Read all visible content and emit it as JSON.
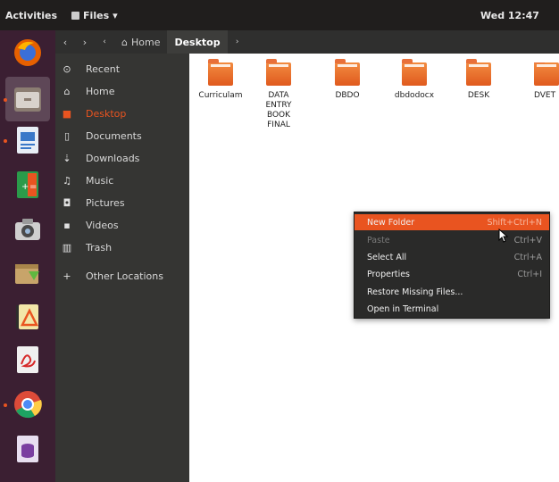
{
  "topbar": {
    "activities": "Activities",
    "app_name": "Files",
    "clock": "Wed 12:47"
  },
  "dock": {
    "items": [
      {
        "name": "firefox-icon",
        "color": "#e66000"
      },
      {
        "name": "files-icon",
        "color": "#8b7d72"
      },
      {
        "name": "writer-icon",
        "color": "#3a78c8"
      },
      {
        "name": "calc-icon",
        "color": "#2a9b4a"
      },
      {
        "name": "camera-icon",
        "color": "#9a9a9a"
      },
      {
        "name": "software-install-icon",
        "color": "#c8a46a"
      },
      {
        "name": "draw-icon",
        "color": "#2c2c2c"
      },
      {
        "name": "pdf-reader-icon",
        "color": "#d0d0d0"
      },
      {
        "name": "chrome-icon",
        "color": "#dd4b39"
      },
      {
        "name": "base-icon",
        "color": "#7a3fa0"
      }
    ]
  },
  "header": {
    "back": "‹",
    "forward": "›",
    "home_label": "Home",
    "current_label": "Desktop",
    "more": "›"
  },
  "sidebar": {
    "items": [
      {
        "label": "Recent",
        "icon": "clock-icon",
        "glyph": "⊙"
      },
      {
        "label": "Home",
        "icon": "home-icon",
        "glyph": "⌂"
      },
      {
        "label": "Desktop",
        "icon": "desktop-folder-icon",
        "glyph": "■"
      },
      {
        "label": "Documents",
        "icon": "document-icon",
        "glyph": "▯"
      },
      {
        "label": "Downloads",
        "icon": "download-icon",
        "glyph": "⇣"
      },
      {
        "label": "Music",
        "icon": "music-icon",
        "glyph": "♫"
      },
      {
        "label": "Pictures",
        "icon": "camera-icon",
        "glyph": "◘"
      },
      {
        "label": "Videos",
        "icon": "video-icon",
        "glyph": "▪"
      },
      {
        "label": "Trash",
        "icon": "trash-icon",
        "glyph": "▥"
      },
      {
        "label": "Other Locations",
        "icon": "plus-icon",
        "glyph": "+"
      }
    ]
  },
  "content": {
    "folders": [
      {
        "name": "Curriculam"
      },
      {
        "name": "DATA ENTRY BOOK FINAL"
      },
      {
        "name": "DBDO"
      },
      {
        "name": "dbdodocx"
      },
      {
        "name": "DESK"
      },
      {
        "name": "DVET"
      }
    ]
  },
  "context_menu": {
    "items": [
      {
        "label": "New Folder",
        "shortcut": "Shift+Ctrl+N",
        "state": "highlight"
      },
      {
        "label": "Paste",
        "shortcut": "Ctrl+V",
        "state": "disabled"
      },
      {
        "label": "Select All",
        "shortcut": "Ctrl+A",
        "state": "normal"
      },
      {
        "label": "Properties",
        "shortcut": "Ctrl+I",
        "state": "normal"
      },
      {
        "label": "Restore Missing Files...",
        "shortcut": "",
        "state": "normal"
      },
      {
        "label": "Open in Terminal",
        "shortcut": "",
        "state": "normal"
      }
    ]
  },
  "colors": {
    "accent": "#e95420",
    "dock_bg": "#3b1f32",
    "sidebar_bg": "#353533"
  }
}
